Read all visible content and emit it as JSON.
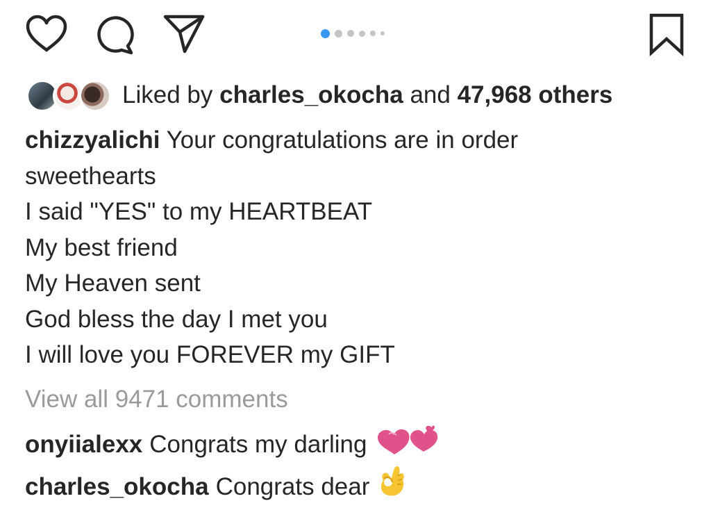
{
  "actions": {
    "icons": [
      "heart-icon",
      "comment-icon",
      "share-icon",
      "bookmark-icon"
    ],
    "carousel": {
      "count": 6,
      "active_index": 0,
      "active_color": "#3897f0",
      "inactive_color": "#c4c4c4"
    }
  },
  "likes": {
    "prefix": "Liked by",
    "user": "charles_okocha",
    "joiner": "and",
    "others": "47,968 others"
  },
  "caption": {
    "username": "chizzyalichi",
    "lines": [
      "Your congratulations are in order",
      "sweethearts",
      "I said \"YES\" to my HEARTBEAT",
      "My best friend",
      "My Heaven sent",
      "God bless the day I met you",
      "I will love you FOREVER my GIFT"
    ]
  },
  "view_all": "View all 9471 comments",
  "comments": [
    {
      "username": "onyiialexx",
      "text": "Congrats my darling",
      "emoji": "two-hearts-emoji"
    },
    {
      "username": "charles_okocha",
      "text": "Congrats dear",
      "emoji": "ok-hand-emoji"
    }
  ],
  "colors": {
    "text": "#262626",
    "muted": "#9a9a9a",
    "heart_pink": "#e0528a",
    "ok_hand": "#f7c531"
  }
}
